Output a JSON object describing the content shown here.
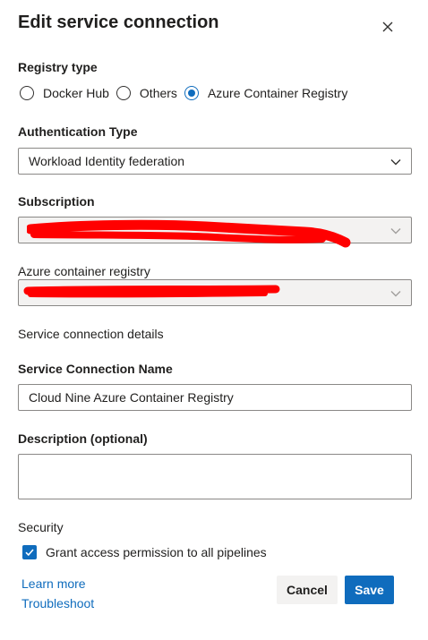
{
  "dialog": {
    "title": "Edit service connection"
  },
  "registry_type": {
    "label": "Registry type",
    "options": [
      {
        "label": "Docker Hub",
        "checked": false
      },
      {
        "label": "Others",
        "checked": false
      },
      {
        "label": "Azure Container Registry",
        "checked": true
      }
    ]
  },
  "authentication": {
    "label": "Authentication Type",
    "value": "Workload Identity federation"
  },
  "subscription": {
    "label": "Subscription",
    "value": ""
  },
  "container_registry": {
    "label": "Azure container registry",
    "value": ""
  },
  "details": {
    "label": "Service connection details"
  },
  "connection_name": {
    "label": "Service Connection Name",
    "value": "Cloud Nine Azure Container Registry"
  },
  "description": {
    "label": "Description (optional)",
    "value": ""
  },
  "security": {
    "label": "Security",
    "grant_access_label": "Grant access permission to all pipelines",
    "grant_access_checked": true
  },
  "links": {
    "learn_more": "Learn more",
    "troubleshoot": "Troubleshoot"
  },
  "buttons": {
    "cancel": "Cancel",
    "save": "Save"
  },
  "colors": {
    "accent": "#0f6cbd",
    "redaction": "#ff0000"
  }
}
